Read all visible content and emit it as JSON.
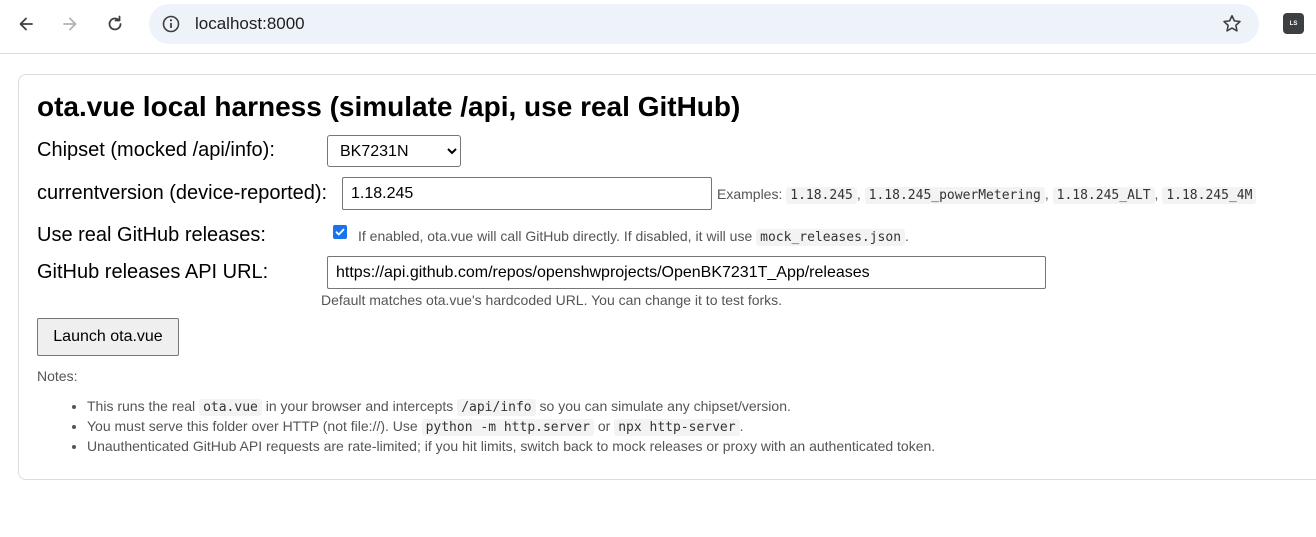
{
  "browser": {
    "url": "localhost:8000",
    "extension_label": "LS"
  },
  "page": {
    "title": "ota.vue local harness (simulate /api, use real GitHub)",
    "chipset": {
      "label": "Chipset (mocked /api/info):",
      "selected": "BK7231N"
    },
    "version": {
      "label": "currentversion (device-reported):",
      "value": "1.18.245",
      "examples_label": "Examples:",
      "examples": [
        "1.18.245",
        "1.18.245_powerMetering",
        "1.18.245_ALT",
        "1.18.245_4M"
      ],
      "sep": ","
    },
    "github_toggle": {
      "label": "Use real GitHub releases:",
      "checked": true,
      "hint_prefix": "If enabled, ota.vue will call GitHub directly. If disabled, it will use",
      "hint_code": "mock_releases.json",
      "hint_suffix": "."
    },
    "api_url": {
      "label": "GitHub releases API URL:",
      "value": "https://api.github.com/repos/openshwprojects/OpenBK7231T_App/releases",
      "hint": "Default matches ota.vue's hardcoded URL. You can change it to test forks."
    },
    "launch_label": "Launch ota.vue",
    "notes_title": "Notes:",
    "notes": {
      "n1_a": "This runs the real",
      "n1_code1": "ota.vue",
      "n1_b": "in your browser and intercepts",
      "n1_code2": "/api/info",
      "n1_c": "so you can simulate any chipset/version.",
      "n2_a": "You must serve this folder over HTTP (not file://). Use",
      "n2_code1": "python -m http.server",
      "n2_b": "or",
      "n2_code2": "npx http-server",
      "n2_c": ".",
      "n3": "Unauthenticated GitHub API requests are rate-limited; if you hit limits, switch back to mock releases or proxy with an authenticated token."
    }
  }
}
